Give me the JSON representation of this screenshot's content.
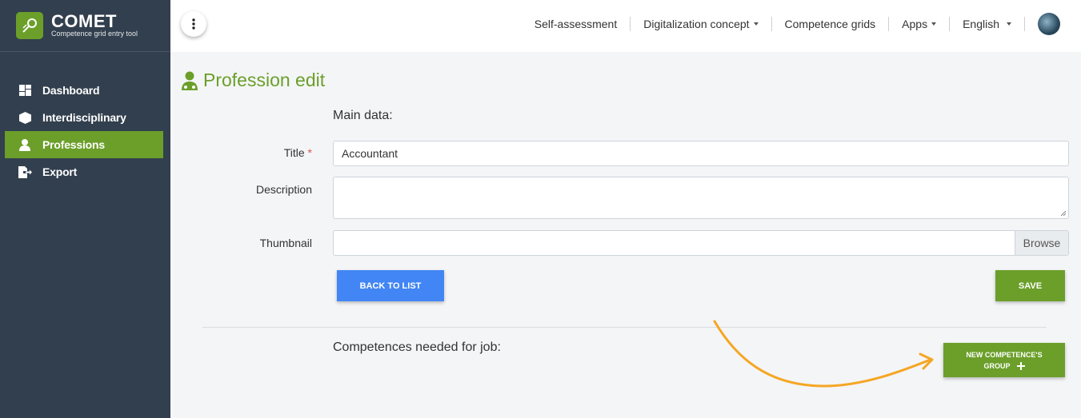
{
  "brand": {
    "title": "COMET",
    "subtitle": "Competence grid entry tool"
  },
  "sidebar": {
    "items": [
      {
        "label": "Dashboard",
        "icon": "dashboard-icon",
        "active": false
      },
      {
        "label": "Interdisciplinary",
        "icon": "cube-icon",
        "active": false
      },
      {
        "label": "Professions",
        "icon": "user-icon",
        "active": true
      },
      {
        "label": "Export",
        "icon": "export-icon",
        "active": false
      }
    ]
  },
  "topnav": {
    "items": [
      {
        "label": "Self-assessment",
        "dropdown": false
      },
      {
        "label": "Digitalization concept",
        "dropdown": true
      },
      {
        "label": "Competence grids",
        "dropdown": false
      },
      {
        "label": "Apps",
        "dropdown": true
      },
      {
        "label": "English",
        "dropdown": true
      }
    ]
  },
  "page": {
    "title": "Profession edit"
  },
  "form": {
    "main_data_label": "Main data:",
    "title_label": "Title",
    "title_required_mark": "*",
    "title_value": "Accountant",
    "description_label": "Description",
    "description_value": "",
    "thumbnail_label": "Thumbnail",
    "thumbnail_value": "",
    "browse_label": "Browse",
    "back_label": "BACK TO LIST",
    "save_label": "SAVE"
  },
  "competences": {
    "label": "Competences needed for job:",
    "new_group_line1": "NEW COMPETENCE'S",
    "new_group_line2": "GROUP"
  },
  "colors": {
    "accent": "#6b9f2a",
    "sidebar": "#323f4e",
    "primary_button": "#4285f4",
    "annotation_arrow": "#f5a623"
  }
}
